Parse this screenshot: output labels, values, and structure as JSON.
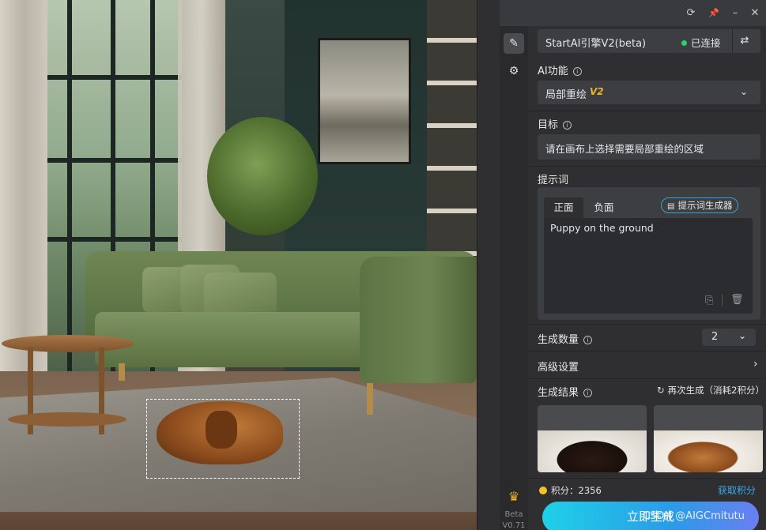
{
  "titlebar": {
    "icons": [
      "refresh-icon",
      "pin-icon",
      "minimize-icon",
      "close-icon"
    ],
    "glyphs": [
      "⟳",
      "📌",
      "–",
      "✕"
    ]
  },
  "sidebar": {
    "items": [
      {
        "name": "edit-icon",
        "glyph": "✎",
        "active": true
      },
      {
        "name": "settings-icon",
        "glyph": "⚙",
        "active": false
      }
    ],
    "crown_glyph": "♛",
    "beta_label": "Beta",
    "version": "V0.71"
  },
  "engine": {
    "name": "StartAI引擎V2(beta)",
    "status": "已连接",
    "status_color": "#27d36a",
    "switch_icon": "switch-icon"
  },
  "ai_function": {
    "label": "AI功能",
    "selected": "局部重绘",
    "version_badge": "V2",
    "badge_color": "#f0b429"
  },
  "target": {
    "label": "目标",
    "value": "请在画布上选择需要局部重绘的区域"
  },
  "prompt": {
    "label": "提示词",
    "tabs": [
      "正面",
      "负面"
    ],
    "generator_label": "提示词生成器",
    "value": "Puppy on the ground"
  },
  "quantity": {
    "label": "生成数量",
    "value": "2"
  },
  "advanced": {
    "label": "高级设置"
  },
  "results": {
    "label": "生成结果",
    "regenerate_label": "再次生成（消耗2积分）"
  },
  "credits": {
    "label": "积分：2356",
    "get_credits": "获取积分"
  },
  "generate_button": "立即生成",
  "watermark": "CSDN @AIGCmitutu",
  "accent_color": "#2b9be8"
}
